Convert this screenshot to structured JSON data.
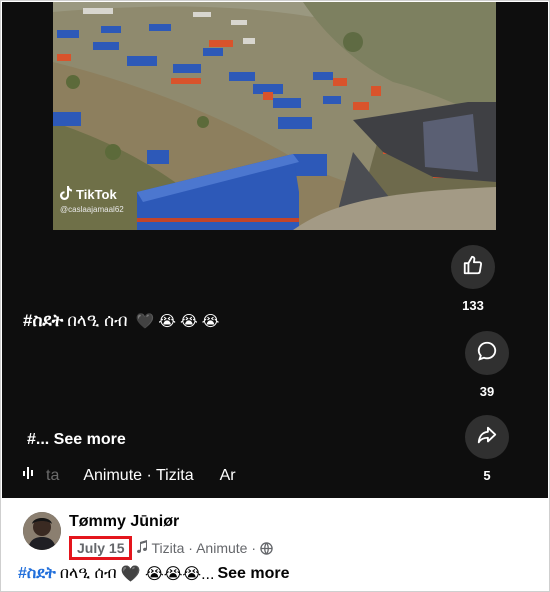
{
  "video": {
    "watermark": {
      "brand": "TikTok",
      "handle": "@caslaajamaal62"
    },
    "caption": {
      "hashtag": "#ስደት",
      "text": "በላዒ ሰብ",
      "emoji": "🖤 😭 😭 😭"
    },
    "see_more": "#... See more",
    "music": {
      "prefix": "ta",
      "track": "Animute · Tizita",
      "next": "Ar"
    },
    "actions": [
      {
        "icon": "thumbs-up-icon",
        "count": "133"
      },
      {
        "icon": "comment-icon",
        "count": "39"
      },
      {
        "icon": "share-icon",
        "count": "5"
      }
    ]
  },
  "post": {
    "author": "Tømmy Jūniør",
    "date": "July 15",
    "music": "Tizita · Animute ·",
    "privacy_icon": "globe-icon",
    "text": {
      "hashtag": "#ስደት",
      "body": "በላዒ ሰብ",
      "emoji": "🖤 😭😭😭...",
      "see_more": "See more"
    }
  },
  "colors": {
    "video_bg": "#0e0e0e",
    "highlight": "#e4151c",
    "link": "#216fdb",
    "button_bg": "#303030"
  }
}
